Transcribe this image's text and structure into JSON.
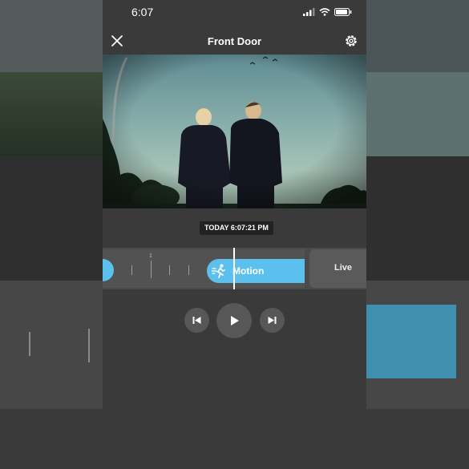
{
  "status_bar": {
    "time": "6:07"
  },
  "header": {
    "title": "Front Door"
  },
  "player": {
    "timestamp": "TODAY 6:07:21 PM",
    "timeline": {
      "tick_label": "1",
      "event_label": "Motion",
      "live_label": "Live"
    }
  },
  "colors": {
    "accent": "#5cc0ef",
    "screen_bg": "#3a3a3a",
    "timeline_bg": "#4a4a4a"
  },
  "icons": [
    "close-icon",
    "settings-gear-icon",
    "signal-icon",
    "wifi-icon",
    "battery-icon",
    "running-person-icon",
    "skip-previous-icon",
    "play-icon",
    "skip-next-icon"
  ]
}
